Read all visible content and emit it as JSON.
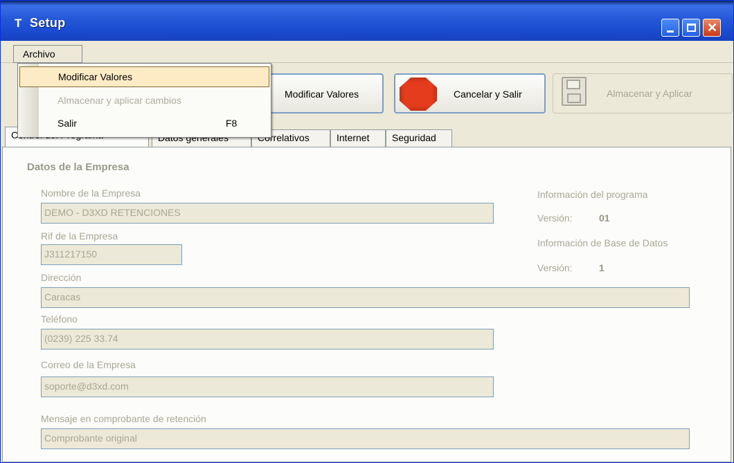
{
  "window": {
    "title": "Setup",
    "icon": "hammer-icon"
  },
  "menubar": {
    "archivo": "Archivo"
  },
  "menu_archivo": {
    "items": [
      {
        "label": "Modificar Valores",
        "highlighted": true
      },
      {
        "label": "Almacenar y aplicar cambios",
        "disabled": true
      },
      {
        "label": "Salir",
        "shortcut": "F8"
      }
    ]
  },
  "toolbar": {
    "modify": "Modificar Valores",
    "cancel": "Cancelar y Salir",
    "save": "Almacenar y Aplicar",
    "cancel_icon": "stop-icon",
    "save_icon": "floppy-disk-icon"
  },
  "tabs": [
    {
      "label": "Control del Programa",
      "active": true
    },
    {
      "label": "Datos generales"
    },
    {
      "label": "Correlativos"
    },
    {
      "label": "Internet"
    },
    {
      "label": "Seguridad"
    }
  ],
  "form": {
    "group_title": "Datos de la Empresa",
    "company_name_label": "Nombre de la Empresa",
    "company_name": "DEMO - D3XD RETENCIONES",
    "rif_label": "Rif de la Empresa",
    "rif": "J311217150",
    "address_label": "Dirección",
    "address": "Caracas",
    "phone_label": "Teléfono",
    "phone": "(0239) 225 33.74",
    "email_label": "Correo de la Empresa",
    "email": "soporte@d3xd.com",
    "message_label": "Mensaje en comprobante de retención",
    "message": "Comprobante original"
  },
  "info": {
    "program_label": "Información del programa",
    "program_version_label": "Versión:",
    "program_version": "01",
    "db_label": "Información de Base de Datos",
    "db_version_label": "Versión:",
    "db_version": "1"
  },
  "colors": {
    "titlebar": "#2458d8",
    "window_bg": "#ece9d8",
    "highlight": "#fcebc4",
    "stop": "#e53c1e"
  }
}
